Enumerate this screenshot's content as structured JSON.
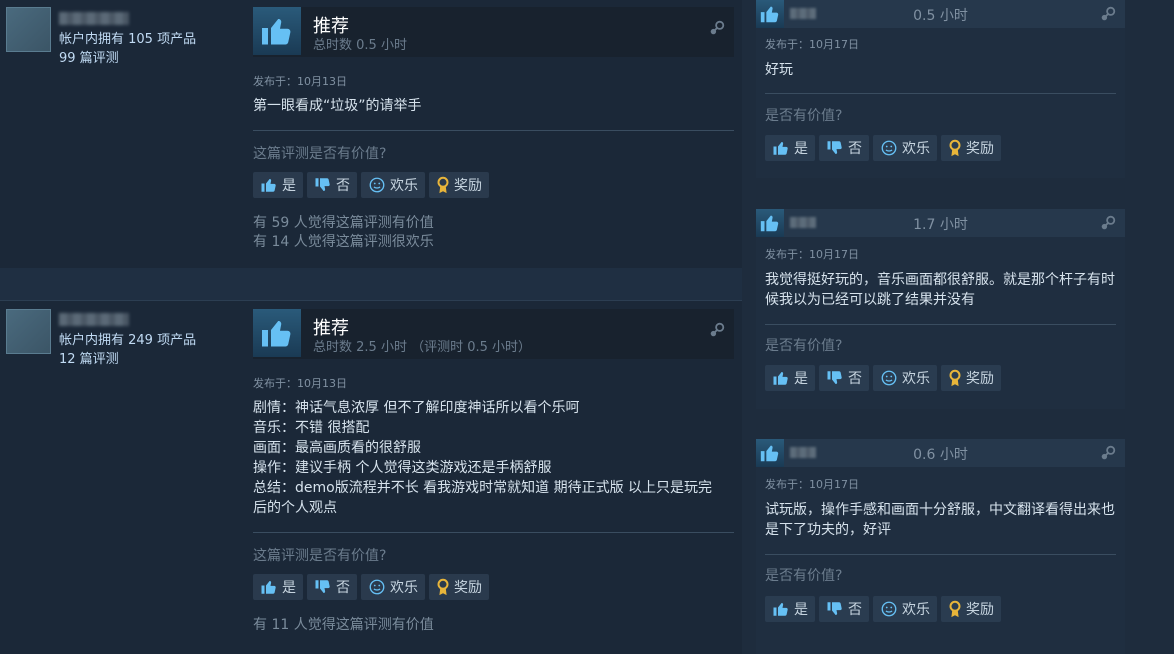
{
  "reviews": [
    {
      "owned": "帐户内拥有 105 项产品",
      "review_count": "99 篇评测",
      "title": "推荐",
      "hours": "总时数 0.5 小时",
      "posted": "发布于：10月13日",
      "body": "第一眼看成“垃圾”的请举手",
      "question": "这篇评测是否有价值?",
      "buttons": {
        "yes": "是",
        "no": "否",
        "funny": "欢乐",
        "award": "奖励"
      },
      "stats": [
        "有 59 人觉得这篇评测有价值",
        "有 14 人觉得这篇评测很欢乐"
      ]
    },
    {
      "owned": "帐户内拥有 249 项产品",
      "review_count": "12 篇评测",
      "title": "推荐",
      "hours": "总时数 2.5 小时 （评测时 0.5 小时）",
      "posted": "发布于：10月13日",
      "body": "剧情：神话气息浓厚 但不了解印度神话所以看个乐呵\n音乐：不错 很搭配\n画面：最高画质看的很舒服\n操作：建议手柄 个人觉得这类游戏还是手柄舒服\n总结：demo版流程并不长 看我游戏时常就知道 期待正式版 以上只是玩完后的个人观点",
      "question": "这篇评测是否有价值?",
      "buttons": {
        "yes": "是",
        "no": "否",
        "funny": "欢乐",
        "award": "奖励"
      },
      "stats": [
        "有 11 人觉得这篇评测有价值"
      ]
    }
  ],
  "side_reviews": [
    {
      "hours": "0.5 小时",
      "posted": "发布于：10月17日",
      "body": "好玩",
      "question": "是否有价值?",
      "buttons": {
        "yes": "是",
        "no": "否",
        "funny": "欢乐",
        "award": "奖励"
      }
    },
    {
      "hours": "1.7 小时",
      "posted": "发布于：10月17日",
      "body": "我觉得挺好玩的，音乐画面都很舒服。就是那个杆子有时候我以为已经可以跳了结果并没有",
      "question": "是否有价值?",
      "buttons": {
        "yes": "是",
        "no": "否",
        "funny": "欢乐",
        "award": "奖励"
      }
    },
    {
      "hours": "0.6 小时",
      "posted": "发布于：10月17日",
      "body": "试玩版，操作手感和画面十分舒服，中文翻译看得出来也是下了功夫的，好评",
      "question": "是否有价值?",
      "buttons": {
        "yes": "是",
        "no": "否",
        "funny": "欢乐",
        "award": "奖励"
      }
    }
  ],
  "colors": {
    "background": "#1b2838",
    "accent": "#66c0f4",
    "award": "#e8b53a"
  },
  "icons": [
    "thumbs-up-icon",
    "thumbs-down-icon",
    "smiley-icon",
    "award-icon",
    "steam-icon"
  ]
}
